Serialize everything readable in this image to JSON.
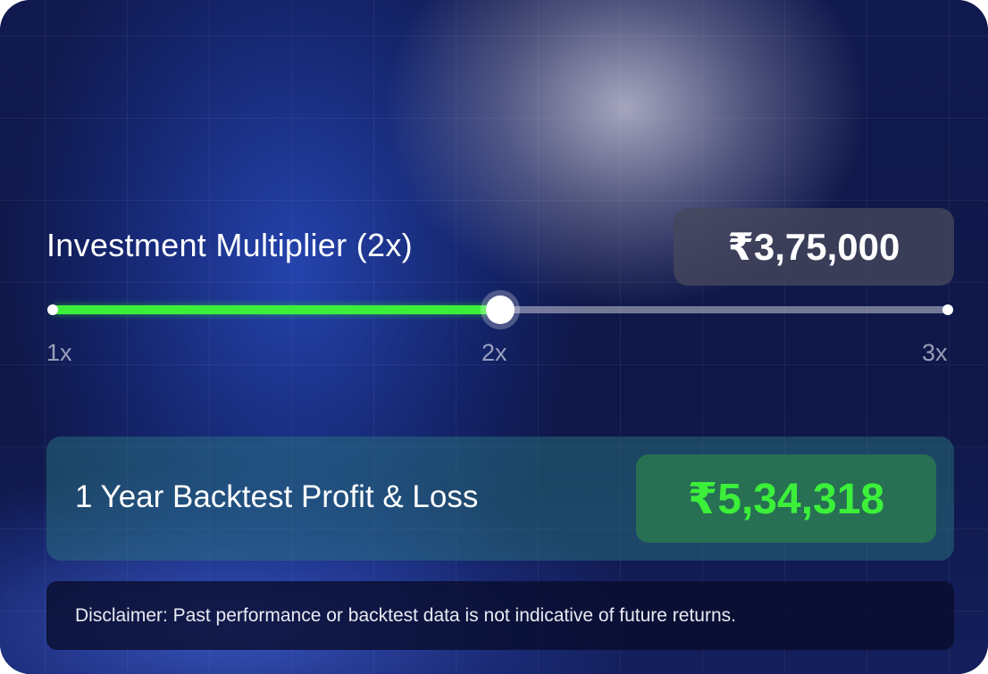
{
  "multiplier": {
    "title": "Investment Multiplier (2x)",
    "amount": "₹3,75,000",
    "slider": {
      "min_label": "1x",
      "mid_label": "2x",
      "max_label": "3x",
      "value_fraction": 0.5
    }
  },
  "backtest": {
    "label": "1 Year Backtest Profit & Loss",
    "value": "₹5,34,318"
  },
  "disclaimer": {
    "text": "Disclaimer: Past performance or backtest data is not indicative of future returns."
  },
  "colors": {
    "accent_green": "#3cf03a",
    "background_navy": "#0f1748"
  }
}
